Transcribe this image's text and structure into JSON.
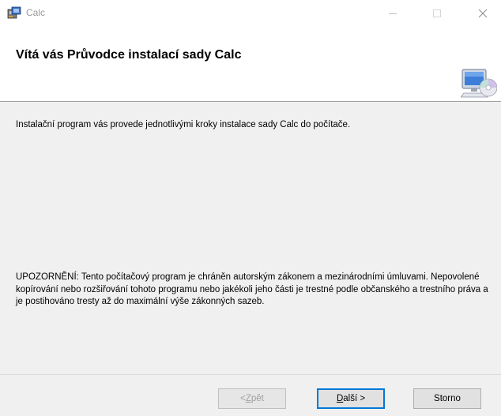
{
  "window": {
    "title": "Calc",
    "minimize_icon": "minimize-icon",
    "maximize_icon": "maximize-icon",
    "close_icon": "close-icon"
  },
  "header": {
    "title": "Vítá vás Průvodce instalací sady Calc",
    "icon": "computer-cd-icon"
  },
  "body": {
    "intro": "Instalační program vás provede jednotlivými kroky instalace sady Calc do počítače.",
    "warning": "UPOZORNĚNÍ: Tento počítačový program je chráněn autorským zákonem a mezinárodními úmluvami. Nepovolené kopírování nebo rozšiřování tohoto programu nebo jakékoli jeho části je trestné podle občanského a trestního práva a je postihováno tresty až do maximální výše zákonných sazeb."
  },
  "buttons": {
    "back": {
      "prefix": "< ",
      "accel": "Z",
      "rest": "pět",
      "enabled": false
    },
    "next": {
      "accel": "D",
      "rest": "alší >",
      "default": true
    },
    "cancel": {
      "label": "Storno"
    }
  },
  "colors": {
    "accent": "#0078d7",
    "footer_bg": "#f0f0f0",
    "title_text": "#9a9a9a"
  }
}
